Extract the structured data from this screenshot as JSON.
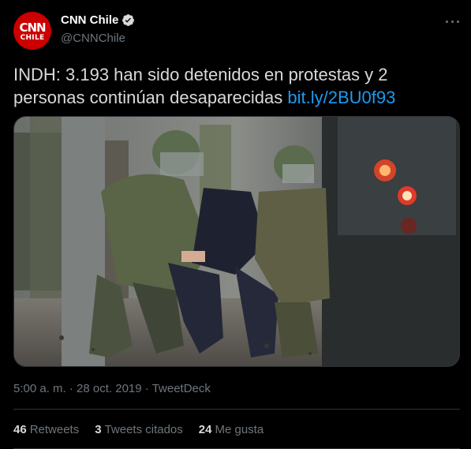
{
  "author": {
    "display_name": "CNN Chile",
    "handle": "@CNNChile",
    "avatar_logo": "CNN",
    "avatar_sub": "CHILE",
    "verified": true
  },
  "tweet": {
    "text": "INDH: 3.193 han sido detenidos en protestas y 2 personas continúan desaparecidas ",
    "link": "bit.ly/2BU0f93"
  },
  "media": {
    "icon": "photo"
  },
  "meta": {
    "time": "5:00 a. m.",
    "date": "28 oct. 2019",
    "source": "TweetDeck",
    "sep": "·"
  },
  "stats": {
    "retweets": {
      "count": "46",
      "label": "Retweets"
    },
    "quotes": {
      "count": "3",
      "label": "Tweets citados"
    },
    "likes": {
      "count": "24",
      "label": "Me gusta"
    }
  },
  "colors": {
    "background": "#000000",
    "text": "#d9d9d9",
    "muted": "#6e767d",
    "link": "#1d9bf0",
    "brand_red": "#cc0000",
    "verified": "#d9d9d9"
  },
  "icons": {
    "verified": "verified-badge-icon",
    "more": "more-options-icon"
  }
}
